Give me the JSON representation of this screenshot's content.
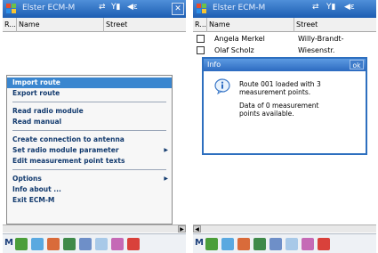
{
  "left": {
    "title": "Elster ECM-M",
    "columns": [
      "R...",
      "Name",
      "Street"
    ],
    "menu": {
      "items": [
        {
          "label": "Import route",
          "highlight": true
        },
        {
          "label": "Export route"
        },
        {
          "label": "Read radio module"
        },
        {
          "label": "Read manual"
        },
        {
          "label": "Create connection to antenna"
        },
        {
          "label": "Set radio module parameter",
          "submenu": true
        },
        {
          "label": "Edit measurement point texts"
        },
        {
          "label": "Options",
          "submenu": true
        },
        {
          "label": "Info about ..."
        },
        {
          "label": "Exit ECM-M"
        }
      ]
    },
    "taskbar_lead": "M"
  },
  "right": {
    "title": "Elster ECM-M",
    "columns": [
      "R...",
      "Name",
      "Street"
    ],
    "rows": [
      {
        "name": "Angela Merkel",
        "street": "Willy-Brandt-"
      },
      {
        "name": "Olaf Scholz",
        "street": "Wiesenstr."
      }
    ],
    "dialog": {
      "title": "Info",
      "ok": "ok",
      "line1": "Route 001 loaded with 3",
      "line2": "measurement points.",
      "line3": "Data of 0 measurement",
      "line4": "points available."
    },
    "taskbar_lead": "M"
  },
  "icons": {
    "app": "windows-flag-icon",
    "signal": "signal-icon",
    "speaker": "speaker-icon",
    "close": "close-icon",
    "info": "info-speech-icon"
  },
  "colors": {
    "titlebar": "#2c6ac0",
    "highlight": "#3a86cf",
    "menu_text": "#123a6e"
  }
}
